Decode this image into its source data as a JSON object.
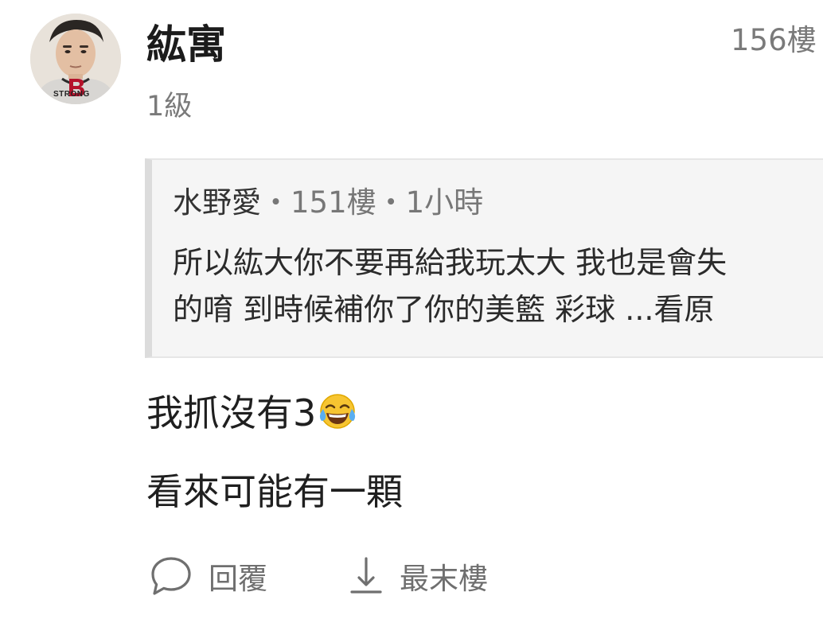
{
  "post": {
    "username": "紘寓",
    "floor": "156樓",
    "level": "1級",
    "avatar_badge": "STRONG"
  },
  "quote": {
    "author": "水野愛",
    "separator1": "・",
    "floor": "151樓",
    "separator2": "・",
    "time": "1小時",
    "line1": "所以紘大你不要再給我玩太大 我也是會失",
    "line2": "的唷 到時候補你了你的美籃 彩球 ...看原"
  },
  "content": {
    "line1": "我抓沒有3",
    "line1_emoji": "face-with-tears-of-joy",
    "line2": "看來可能有一顆"
  },
  "actions": {
    "reply_label": "回覆",
    "reply_icon": "speech-bubble-icon",
    "last_floor_label": "最末樓",
    "last_floor_icon": "arrow-down-to-line-icon"
  },
  "colors": {
    "text_primary": "#1f1f1f",
    "text_secondary": "#7a7a7a",
    "quote_background": "#f5f5f5",
    "quote_border": "#dcdcdc",
    "avatar_logo_red": "#b5122b"
  }
}
